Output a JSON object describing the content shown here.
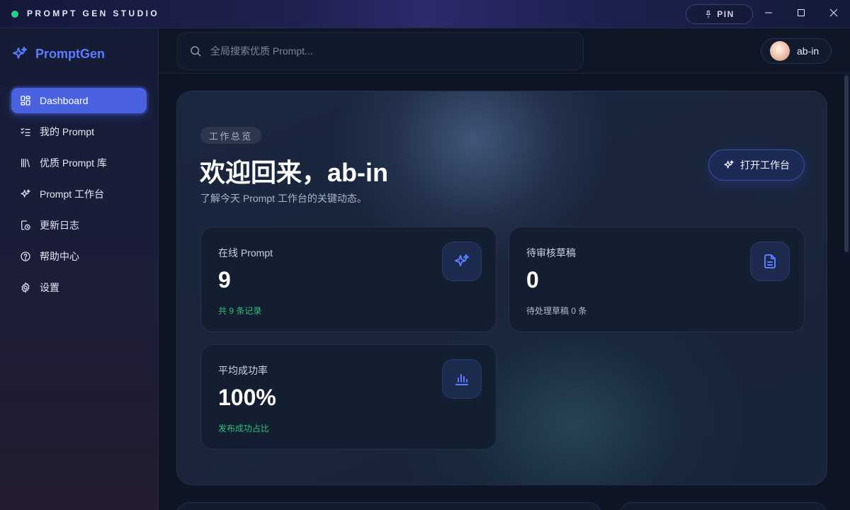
{
  "titlebar": {
    "title": "PROMPT GEN STUDIO",
    "pin_label": "PIN"
  },
  "brand": {
    "name": "PromptGen"
  },
  "nav": {
    "items": [
      {
        "label": "Dashboard",
        "icon": "grid-icon",
        "active": true
      },
      {
        "label": "我的 Prompt",
        "icon": "checklist-icon",
        "active": false
      },
      {
        "label": "优质 Prompt 库",
        "icon": "library-icon",
        "active": false
      },
      {
        "label": "Prompt 工作台",
        "icon": "sparkles-icon",
        "active": false
      },
      {
        "label": "更新日志",
        "icon": "history-icon",
        "active": false
      },
      {
        "label": "帮助中心",
        "icon": "help-icon",
        "active": false
      },
      {
        "label": "设置",
        "icon": "gear-icon",
        "active": false
      }
    ]
  },
  "search": {
    "placeholder": "全局搜索优质 Prompt..."
  },
  "user": {
    "name": "ab-in"
  },
  "hero": {
    "badge": "工作总览",
    "title": "欢迎回来，ab-in",
    "subtitle": "了解今天 Prompt 工作台的关键动态。",
    "open_button": "打开工作台"
  },
  "stats": [
    {
      "label": "在线 Prompt",
      "value": "9",
      "note": "共 9 条记录",
      "icon": "sparkles-icon"
    },
    {
      "label": "待审核草稿",
      "value": "0",
      "note": "待处理草稿 0 条",
      "icon": "document-icon"
    },
    {
      "label": "平均成功率",
      "value": "100%",
      "note": "发布成功占比",
      "icon": "bar-chart-icon"
    }
  ],
  "colors": {
    "accent": "#4a62e0",
    "brand": "#5a7cff",
    "success": "#2fbf7a",
    "online_dot": "#27d08a"
  }
}
